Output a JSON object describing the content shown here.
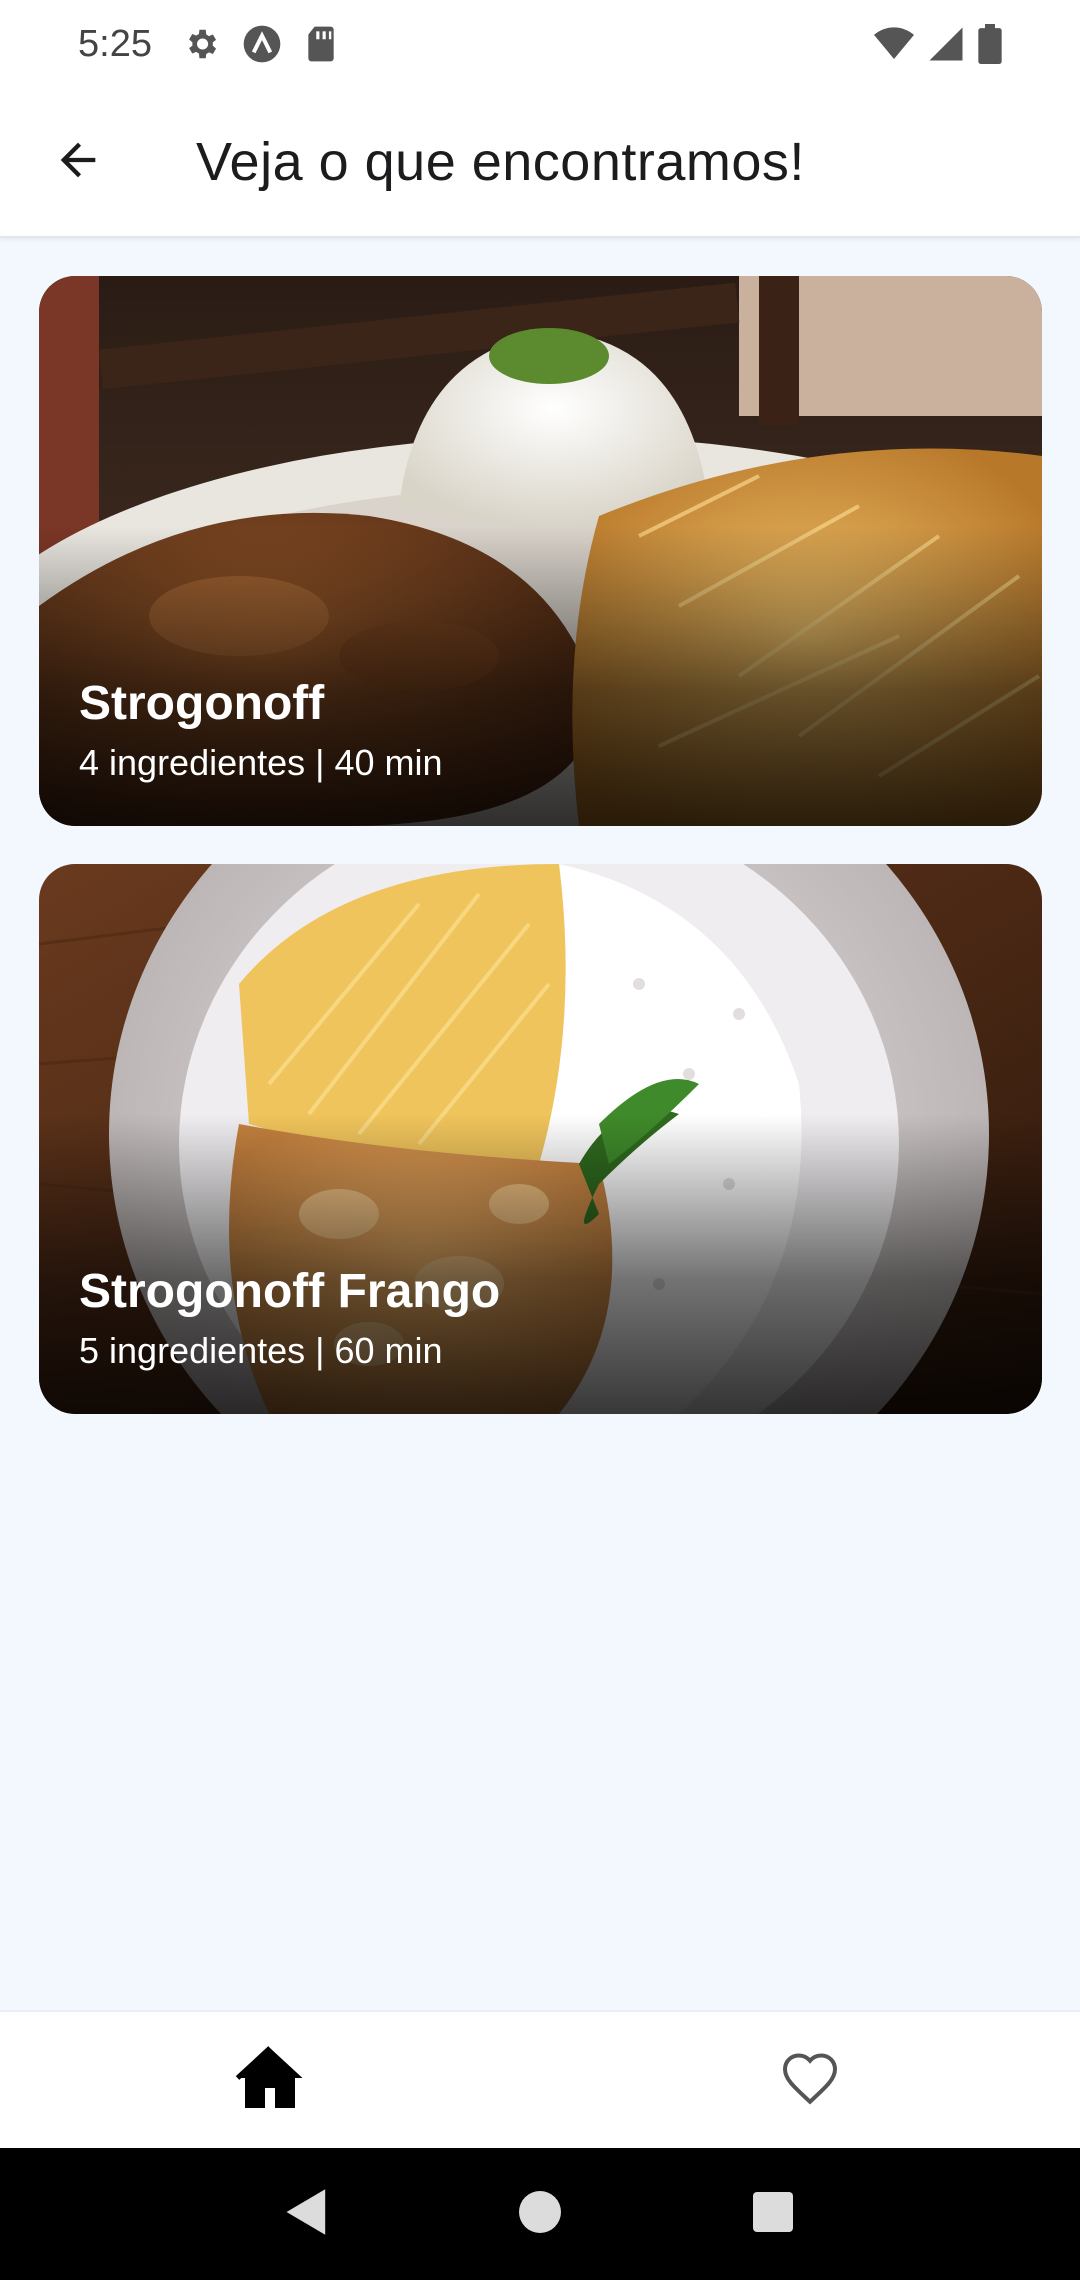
{
  "status_bar": {
    "time": "5:25",
    "left_icons": [
      "gear-icon",
      "app-a-icon",
      "sd-card-icon"
    ],
    "right_icons": [
      "wifi-icon",
      "signal-icon",
      "battery-icon"
    ]
  },
  "app_bar": {
    "title": "Veja o que encontramos!",
    "back_icon": "arrow-back-icon"
  },
  "recipes": [
    {
      "title": "Strogonoff",
      "meta": "4 ingredientes | 40 min",
      "image": "strogonoff-photo"
    },
    {
      "title": "Strogonoff Frango",
      "meta": "5 ingredientes | 60 min",
      "image": "strogonoff-frango-photo"
    }
  ],
  "bottom_nav": {
    "items": [
      {
        "icon": "home-icon",
        "active": true
      },
      {
        "icon": "heart-icon",
        "active": false
      }
    ]
  },
  "system_nav": [
    "back-triangle-icon",
    "home-circle-icon",
    "recents-square-icon"
  ],
  "colors": {
    "background": "#f3f7fe",
    "surface": "#ffffff",
    "text": "#1c1c1e"
  }
}
